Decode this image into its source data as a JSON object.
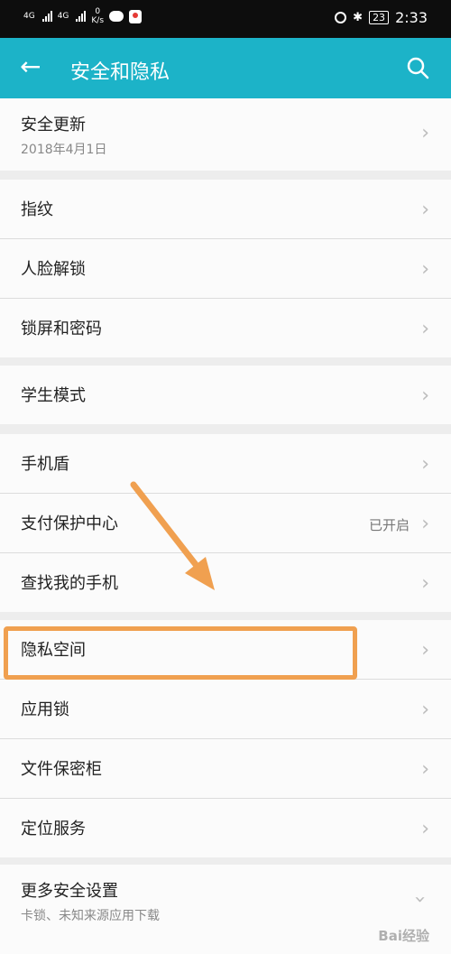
{
  "status": {
    "net1": "4G",
    "net2": "4G",
    "speed_value": "0",
    "speed_unit": "K/s",
    "battery": "23",
    "time": "2:33"
  },
  "appbar": {
    "title": "安全和隐私"
  },
  "groups": [
    [
      {
        "label": "安全更新",
        "sub": "2018年4月1日"
      }
    ],
    [
      {
        "label": "指纹"
      },
      {
        "label": "人脸解锁"
      },
      {
        "label": "锁屏和密码"
      }
    ],
    [
      {
        "label": "学生模式"
      }
    ],
    [
      {
        "label": "手机盾"
      },
      {
        "label": "支付保护中心",
        "value": "已开启"
      },
      {
        "label": "查找我的手机"
      }
    ],
    [
      {
        "label": "隐私空间"
      },
      {
        "label": "应用锁"
      },
      {
        "label": "文件保密柜"
      },
      {
        "label": "定位服务"
      }
    ],
    [
      {
        "label": "更多安全设置",
        "sub": "卡锁、未知来源应用下载"
      }
    ]
  ],
  "chevron": "›",
  "annotation": {
    "arrow_color": "#f0a050",
    "highlight_target": "隐私空间"
  },
  "watermark": "Bai经验"
}
